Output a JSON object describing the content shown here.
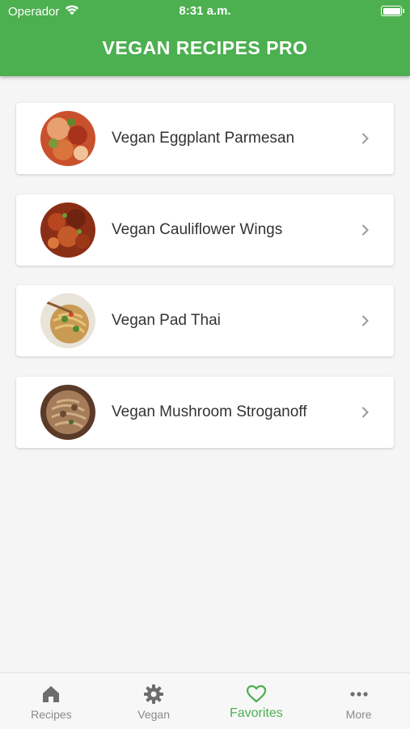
{
  "status_bar": {
    "carrier": "Operador",
    "time": "8:31 a.m."
  },
  "header": {
    "title": "VEGAN RECIPES PRO"
  },
  "recipes": [
    {
      "name": "Vegan Eggplant Parmesan"
    },
    {
      "name": "Vegan Cauliflower Wings"
    },
    {
      "name": "Vegan Pad Thai"
    },
    {
      "name": "Vegan Mushroom Stroganoff"
    }
  ],
  "tab_bar": {
    "tabs": [
      {
        "label": "Recipes",
        "icon": "home-icon"
      },
      {
        "label": "Vegan",
        "icon": "gear-icon"
      },
      {
        "label": "Favorites",
        "icon": "heart-icon",
        "active": true
      },
      {
        "label": "More",
        "icon": "more-icon"
      }
    ]
  },
  "colors": {
    "primary": "#4caf50",
    "background": "#f5f5f5",
    "card": "#ffffff",
    "text": "#333333",
    "inactive_tab": "#8a8a8a"
  }
}
